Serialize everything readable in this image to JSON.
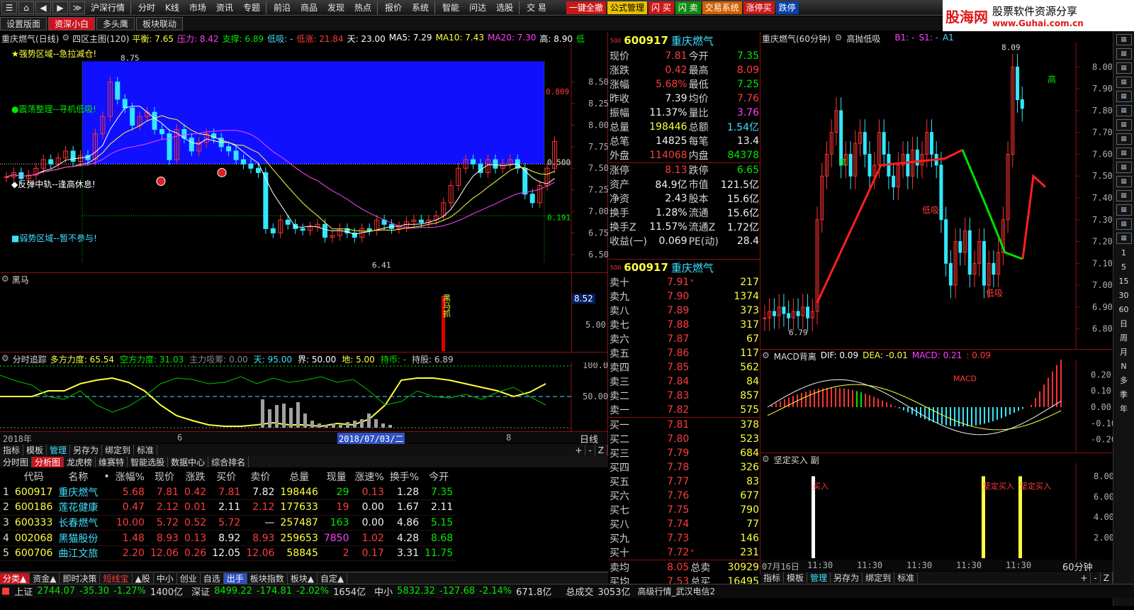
{
  "topmenu": {
    "items": [
      "沪深行情",
      "分时",
      "K线",
      "市场",
      "资讯",
      "专题",
      "前沿",
      "商品",
      "发现",
      "热点",
      "报价",
      "系统",
      "智能",
      "问达",
      "选股",
      "交 易"
    ],
    "right_buttons": [
      {
        "label": "一键全撤",
        "bg": "#c81818",
        "fg": "#ffffff"
      },
      {
        "label": "公式管理",
        "bg": "#e8c000",
        "fg": "#000000"
      },
      {
        "label": "闪 买",
        "bg": "#c81818",
        "fg": "#ffffff"
      },
      {
        "label": "闪 卖",
        "bg": "#108a10",
        "fg": "#ffffff"
      },
      {
        "label": "交易系统",
        "bg": "#d06000",
        "fg": "#ffffff"
      },
      {
        "label": "涨停买",
        "bg": "#c81818",
        "fg": "#ffffff"
      },
      {
        "label": "跌停",
        "bg": "#0840a8",
        "fg": "#ffffff"
      }
    ]
  },
  "logo": {
    "brand": "股海网",
    "tagline": "股票软件资源分享",
    "url": "www.Guhai.com.cn"
  },
  "tabs": [
    "设置版面",
    "资深小白",
    "多头鹰",
    "板块联动"
  ],
  "main_chart": {
    "title": "重庆燃气(日线)",
    "indicator_name": "四区主图(120)",
    "indicators": [
      {
        "label": "平衡: 7.65",
        "color": "#ffff40"
      },
      {
        "label": "压力: 8.42",
        "color": "#ff40ff"
      },
      {
        "label": "支撑: 6.89",
        "color": "#00e800"
      },
      {
        "label": "低吸: -",
        "color": "#40e0ff"
      },
      {
        "label": "低涨: 21.84",
        "color": "#ff3c3c"
      },
      {
        "label": "天: 23.00",
        "color": "#ffffff"
      },
      {
        "label": "MA5: 7.29",
        "color": "#ffffff"
      },
      {
        "label": "MA10: 7.43",
        "color": "#ffff40"
      },
      {
        "label": "MA20: 7.30",
        "color": "#ff40ff"
      },
      {
        "label": "高: 8.90",
        "color": "#ffffff"
      },
      {
        "label": "低",
        "color": "#00e800"
      }
    ],
    "zone_labels": [
      "★强势区域--急拉减仓!",
      "●震荡整理--寻机低吸!",
      "◆反弹中轨--逢高休息!",
      "■弱势区域--暂不参与!"
    ],
    "price_axis": [
      "8.50",
      "8.25",
      "8.00",
      "7.75",
      "7.50",
      "7.25",
      "7.00",
      "6.75",
      "6.50"
    ],
    "annotations": {
      "high": "8.75",
      "low": "6.41",
      "level1": "0.809",
      "level2": "0.500",
      "level3": "0.191"
    }
  },
  "heima": {
    "title": "黑马",
    "value": "8.52",
    "axis": "5.00",
    "signal": "黑马抓"
  },
  "fenshi": {
    "title": "分时追踪",
    "indicators": [
      {
        "label": "多方力度: 65.54",
        "color": "#ffff40"
      },
      {
        "label": "空方力度: 31.03",
        "color": "#00e800"
      },
      {
        "label": "主力吸筹: 0.00",
        "color": "#888888"
      },
      {
        "label": "天: 95.00",
        "color": "#40e0ff"
      },
      {
        "label": "界: 50.00",
        "color": "#ffffff"
      },
      {
        "label": "地: 5.00",
        "color": "#ffff40"
      },
      {
        "label": "持币: -",
        "color": "#00e800"
      },
      {
        "label": "持股: 6.89",
        "color": "#cccccc"
      }
    ],
    "axis": [
      "100.0",
      "50.00"
    ]
  },
  "timeline": {
    "year": "2018年",
    "m1": "6",
    "date": "2018/07/03/二",
    "m2": "8",
    "period": "日线"
  },
  "left_toolbar": [
    "指标",
    "模板",
    "管理",
    "另存为",
    "绑定到",
    "标准"
  ],
  "quote": {
    "code": "600917",
    "name": "重庆燃气",
    "rows": [
      {
        "k1": "现价",
        "v1": "7.81",
        "c1": "red",
        "k2": "今开",
        "v2": "7.35",
        "c2": "green"
      },
      {
        "k1": "涨跌",
        "v1": "0.42",
        "c1": "red",
        "k2": "最高",
        "v2": "8.09",
        "c2": "red"
      },
      {
        "k1": "涨幅",
        "v1": "5.68%",
        "c1": "red",
        "k2": "最低",
        "v2": "7.25",
        "c2": "green"
      },
      {
        "k1": "昨收",
        "v1": "7.39",
        "c1": "white",
        "k2": "均价",
        "v2": "7.76",
        "c2": "red"
      },
      {
        "k1": "振幅",
        "v1": "11.37%",
        "c1": "white",
        "k2": "量比",
        "v2": "3.76",
        "c2": "magenta"
      },
      {
        "k1": "总量",
        "v1": "198446",
        "c1": "yellow",
        "k2": "总额",
        "v2": "1.54亿",
        "c2": "cyan"
      },
      {
        "k1": "总笔",
        "v1": "14825",
        "c1": "white",
        "k2": "每笔",
        "v2": "13.4",
        "c2": "white"
      },
      {
        "k1": "外盘",
        "v1": "114068",
        "c1": "red",
        "k2": "内盘",
        "v2": "84378",
        "c2": "green"
      },
      {
        "k1": "涨停",
        "v1": "8.13",
        "c1": "red",
        "k2": "跌停",
        "v2": "6.65",
        "c2": "green"
      },
      {
        "k1": "资产",
        "v1": "84.9亿",
        "c1": "white",
        "k2": "市值",
        "v2": "121.5亿",
        "c2": "white"
      },
      {
        "k1": "净资",
        "v1": "2.43",
        "c1": "white",
        "k2": "股本",
        "v2": "15.6亿",
        "c2": "white"
      },
      {
        "k1": "换手",
        "v1": "1.28%",
        "c1": "white",
        "k2": "流通",
        "v2": "15.6亿",
        "c2": "white"
      },
      {
        "k1": "换手Z",
        "v1": "11.57%",
        "c1": "white",
        "k2": "流通Z",
        "v2": "1.72亿",
        "c2": "white"
      },
      {
        "k1": "收益(一)",
        "v1": "0.069",
        "c1": "white",
        "k2": "PE(动)",
        "v2": "28.4",
        "c2": "white"
      }
    ]
  },
  "orderbook": {
    "code": "600917",
    "name": "重庆燃气",
    "asks": [
      {
        "label": "卖十",
        "price": "7.91",
        "vol": "217",
        "mark": "*"
      },
      {
        "label": "卖九",
        "price": "7.90",
        "vol": "1374",
        "mark": ""
      },
      {
        "label": "卖八",
        "price": "7.89",
        "vol": "373",
        "mark": ""
      },
      {
        "label": "卖七",
        "price": "7.88",
        "vol": "317",
        "mark": ""
      },
      {
        "label": "卖六",
        "price": "7.87",
        "vol": "67",
        "mark": ""
      },
      {
        "label": "卖五",
        "price": "7.86",
        "vol": "117",
        "mark": ""
      },
      {
        "label": "卖四",
        "price": "7.85",
        "vol": "562",
        "mark": ""
      },
      {
        "label": "卖三",
        "price": "7.84",
        "vol": "84",
        "mark": ""
      },
      {
        "label": "卖二",
        "price": "7.83",
        "vol": "857",
        "mark": ""
      },
      {
        "label": "卖一",
        "price": "7.82",
        "vol": "575",
        "mark": ""
      }
    ],
    "bids": [
      {
        "label": "买一",
        "price": "7.81",
        "vol": "378",
        "mark": ""
      },
      {
        "label": "买二",
        "price": "7.80",
        "vol": "523",
        "mark": ""
      },
      {
        "label": "买三",
        "price": "7.79",
        "vol": "684",
        "mark": ""
      },
      {
        "label": "买四",
        "price": "7.78",
        "vol": "326",
        "mark": ""
      },
      {
        "label": "买五",
        "price": "7.77",
        "vol": "83",
        "mark": ""
      },
      {
        "label": "买六",
        "price": "7.76",
        "vol": "677",
        "mark": ""
      },
      {
        "label": "买七",
        "price": "7.75",
        "vol": "790",
        "mark": ""
      },
      {
        "label": "买八",
        "price": "7.74",
        "vol": "77",
        "mark": ""
      },
      {
        "label": "买九",
        "price": "7.73",
        "vol": "146",
        "mark": ""
      },
      {
        "label": "买十",
        "price": "7.72",
        "vol": "231",
        "mark": "*"
      }
    ],
    "summary": [
      {
        "k1": "卖均",
        "v1": "8.05",
        "k2": "总卖",
        "v2": "30929"
      },
      {
        "k1": "买均",
        "v1": "7.53",
        "k2": "总买",
        "v2": "16495"
      }
    ]
  },
  "right_chart": {
    "title": "重庆燃气(60分钟)",
    "indicator": "高抛低吸",
    "b1": "B1: -",
    "s1": "S1: -",
    "a1": "A1",
    "high": "8.09",
    "low": "6.79",
    "axis": [
      "8.00",
      "7.90",
      "7.80",
      "7.70",
      "7.60",
      "7.50",
      "7.40",
      "7.30",
      "7.20",
      "7.10",
      "7.00",
      "6.90",
      "6.80"
    ],
    "labels": {
      "gao": "高",
      "xi1": "低吸",
      "xi2": "低吸",
      "gao2": "高"
    }
  },
  "macd": {
    "title": "MACD背离",
    "dif": "DIF: 0.09",
    "dea": "DEA: -0.01",
    "macd": "MACD: 0.21",
    "extra": ": 0.09",
    "label": "MACD",
    "axis": [
      "0.20",
      "0.10",
      "0.00",
      "-0.10",
      "-0.20"
    ]
  },
  "jianding": {
    "title": "坚定买入 副",
    "axis": [
      "8.00",
      "6.00",
      "4.00",
      "2.00"
    ],
    "labels": [
      "买入",
      "坚定买入",
      "坚定买入"
    ]
  },
  "right_timeline": {
    "date": "07月16日",
    "t": "11:30",
    "period": "60分钟"
  },
  "right_toolbar": [
    "指标",
    "模板",
    "管理",
    "另存为",
    "绑定到",
    "标准"
  ],
  "stocklist": {
    "top_tabs": [
      "分时图",
      "分析图",
      "龙虎榜",
      "维赛特",
      "智能选股",
      "数据中心",
      "综合排名"
    ],
    "headers": [
      "",
      "代码",
      "名称",
      "•",
      "涨幅%",
      "现价",
      "涨跌",
      "买价",
      "卖价",
      "总量",
      "现量",
      "涨速%",
      "换手%",
      "今开"
    ],
    "rows": [
      {
        "n": "1",
        "code": "600917",
        "name": "重庆燃气",
        "chg": "5.68",
        "price": "7.81",
        "diff": "0.42",
        "bid": "7.81",
        "ask": "7.82",
        "vol": "198446",
        "cur": "29",
        "spd": "0.13",
        "turn": "1.28",
        "open": "7.35",
        "cc": "red",
        "oc": "green",
        "curc": "green"
      },
      {
        "n": "2",
        "code": "600186",
        "name": "莲花健康",
        "chg": "0.47",
        "price": "2.12",
        "diff": "0.01",
        "bid": "2.11",
        "ask": "2.12",
        "vol": "177633",
        "cur": "19",
        "spd": "0.00",
        "turn": "1.67",
        "open": "2.11",
        "cc": "red",
        "oc": "white",
        "curc": "red"
      },
      {
        "n": "3",
        "code": "600333",
        "name": "长春燃气",
        "chg": "10.00",
        "price": "5.72",
        "diff": "0.52",
        "bid": "5.72",
        "ask": "—",
        "vol": "257487",
        "cur": "163",
        "spd": "0.00",
        "turn": "4.86",
        "open": "5.15",
        "cc": "red",
        "oc": "green",
        "curc": "green"
      },
      {
        "n": "4",
        "code": "002068",
        "name": "黑猫股份",
        "chg": "1.48",
        "price": "8.93",
        "diff": "0.13",
        "bid": "8.92",
        "ask": "8.93",
        "vol": "259653",
        "cur": "7850",
        "spd": "1.02",
        "turn": "4.28",
        "open": "8.68",
        "cc": "red",
        "oc": "green",
        "curc": "magenta"
      },
      {
        "n": "5",
        "code": "600706",
        "name": "曲江文旅",
        "chg": "2.20",
        "price": "12.06",
        "diff": "0.26",
        "bid": "12.05",
        "ask": "12.06",
        "vol": "58845",
        "cur": "2",
        "spd": "0.17",
        "turn": "3.31",
        "open": "11.75",
        "cc": "red",
        "oc": "green",
        "curc": "red"
      }
    ],
    "bottom_tabs": [
      "分类▲",
      "资金▲",
      "即时决策",
      "短线宝",
      "▲股",
      "中小",
      "创业",
      "自选",
      "出手",
      "板块指数",
      "板块▲",
      "自定▲"
    ]
  },
  "statusbar": {
    "sh_label": "上证",
    "sh_val": "2744.07",
    "sh_chg": "-35.30",
    "sh_pct": "-1.27%",
    "sh_amt": "1400亿",
    "sz_label": "深证",
    "sz_val": "8499.22",
    "sz_chg": "-174.81",
    "sz_pct": "-2.02%",
    "sz_amt": "1654亿",
    "zx_label": "中小",
    "zx_val": "5832.32",
    "zx_chg": "-127.68",
    "zx_pct": "-2.14%",
    "zx_amt": "671.8亿",
    "total_label": "总成交",
    "total_val": "3053亿",
    "server": "高级行情_武汉电信2"
  },
  "vtoolbar": [
    "1",
    "5",
    "15",
    "30",
    "60",
    "日",
    "周",
    "月",
    "N",
    "多",
    "季",
    "年"
  ]
}
